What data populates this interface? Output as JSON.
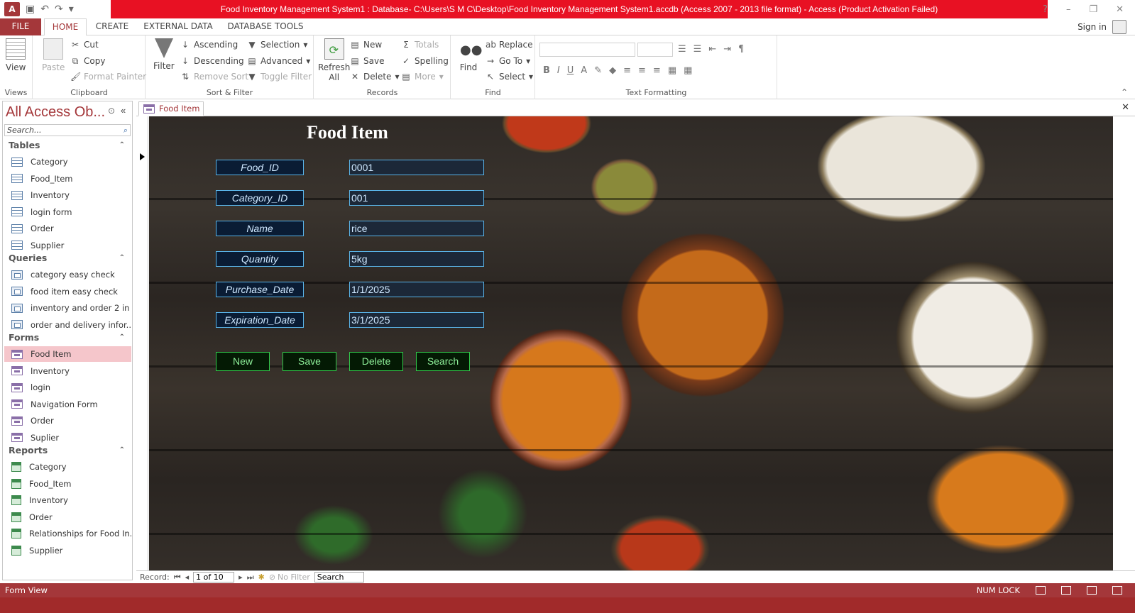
{
  "window": {
    "title": "Food Inventory Management System1 : Database- C:\\Users\\S M C\\Desktop\\Food Inventory Management System1.accdb (Access 2007 - 2013 file format) -  Access (Product Activation Failed)",
    "app_logo": "A",
    "controls": [
      "?",
      "–",
      "❐",
      "✕"
    ]
  },
  "tabs": [
    "FILE",
    "HOME",
    "CREATE",
    "EXTERNAL DATA",
    "DATABASE TOOLS"
  ],
  "sign_in": "Sign in",
  "ribbon": {
    "views": {
      "view": "View",
      "label": "Views"
    },
    "clipboard": {
      "paste": "Paste",
      "cut": "Cut",
      "copy": "Copy",
      "format_painter": "Format Painter",
      "label": "Clipboard"
    },
    "sort_filter": {
      "filter": "Filter",
      "ascending": "Ascending",
      "descending": "Descending",
      "remove_sort": "Remove Sort",
      "selection": "Selection",
      "advanced": "Advanced",
      "toggle_filter": "Toggle Filter",
      "label": "Sort & Filter"
    },
    "records": {
      "refresh": "Refresh",
      "refresh2": "All",
      "new": "New",
      "save": "Save",
      "delete": "Delete",
      "totals": "Totals",
      "spelling": "Spelling",
      "more": "More",
      "label": "Records"
    },
    "find": {
      "find": "Find",
      "replace": "Replace",
      "goto": "Go To",
      "select": "Select",
      "label": "Find"
    },
    "text_formatting": {
      "label": "Text Formatting",
      "bold": "B",
      "italic": "I",
      "underline": "U"
    }
  },
  "nav": {
    "title": "All Access Ob...",
    "search_placeholder": "Search...",
    "sections": [
      {
        "name": "Tables",
        "items": [
          "Category",
          "Food_Item",
          "Inventory",
          "login form",
          "Order",
          "Supplier"
        ]
      },
      {
        "name": "Queries",
        "items": [
          "category easy check",
          "food item easy check",
          "inventory and order 2 in ...",
          "order and delivery  infor..."
        ]
      },
      {
        "name": "Forms",
        "items": [
          "Food Item",
          "Inventory",
          "login",
          "Navigation Form",
          "Order",
          "Suplier"
        ]
      },
      {
        "name": "Reports",
        "items": [
          "Category",
          "Food_Item",
          "Inventory",
          "Order",
          "Relationships for Food In...",
          "Supplier"
        ]
      }
    ],
    "selected": "Food Item"
  },
  "document": {
    "tab": "Food Item",
    "form_title": "Food Item",
    "fields": [
      {
        "label": "Food_ID",
        "value": "0001"
      },
      {
        "label": "Category_ID",
        "value": "001"
      },
      {
        "label": "Name",
        "value": "rice"
      },
      {
        "label": "Quantity",
        "value": "5kg"
      },
      {
        "label": "Purchase_Date",
        "value": "1/1/2025"
      },
      {
        "label": "Expiration_Date",
        "value": "3/1/2025"
      }
    ],
    "buttons": [
      "New",
      "Save",
      "Delete",
      "Search"
    ]
  },
  "record_nav": {
    "label": "Record:",
    "position": "1 of 10",
    "filter": "No Filter",
    "search": "Search"
  },
  "status": {
    "left": "Form View",
    "num_lock": "NUM LOCK"
  },
  "colors": {
    "accent": "#a4373a",
    "title_bar": "#e81123",
    "field_border": "#5ab4e8",
    "button_border": "#31c94a"
  }
}
